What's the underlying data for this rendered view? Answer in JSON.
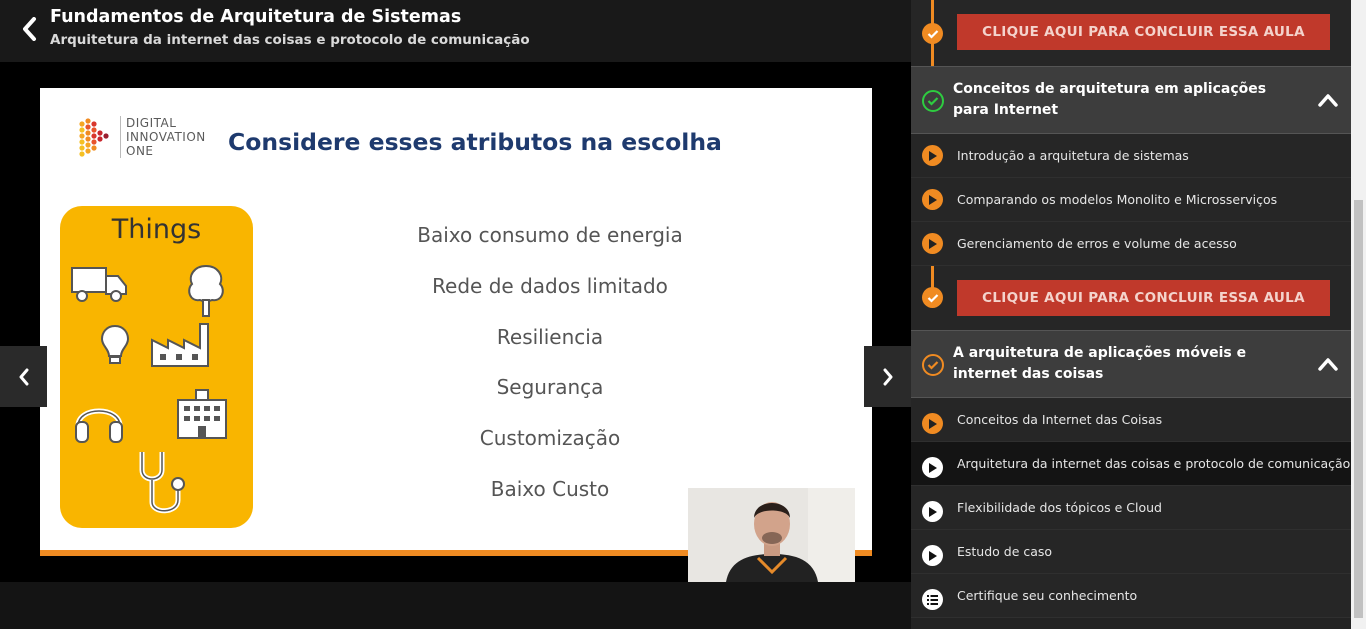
{
  "header": {
    "course_title": "Fundamentos de Arquitetura de Sistemas",
    "lesson_subtitle": "Arquitetura da internet das coisas e protocolo de comunicação"
  },
  "slide": {
    "logo_lines": [
      "DIGITAL",
      "INNOVATION",
      "ONE"
    ],
    "title": "Considere esses atributos na escolha",
    "things_title": "Things",
    "attributes": [
      "Baixo consumo de energia",
      "Rede de dados limitado",
      "Resiliencia",
      "Segurança",
      "Customização",
      "Baixo Custo"
    ]
  },
  "colors": {
    "accent": "#f08b22",
    "conclude_button": "#c0392b",
    "section_complete": "#2ecc40",
    "slide_title": "#1e3a6e",
    "things_card": "#f9b500"
  },
  "sidebar": {
    "conclude_label": "CLIQUE AQUI PARA CONCLUIR ESSA AULA",
    "sections": [
      {
        "title": "Conceitos de arquitetura em aplicações para Internet",
        "status_icon": "check-circle-icon",
        "lessons": [
          "Introdução a arquitetura de sistemas",
          "Comparando os modelos Monolito e Microsserviços",
          "Gerenciamento de erros e volume de acesso"
        ]
      },
      {
        "title": "A arquitetura de aplicações móveis e internet das coisas",
        "status_icon": "check-circle-icon",
        "lessons": [
          "Conceitos da Internet das Coisas",
          "Arquitetura da internet das coisas e protocolo de comunicação",
          "Flexibilidade dos tópicos e Cloud",
          "Estudo de caso",
          "Certifique seu conhecimento"
        ]
      }
    ]
  }
}
